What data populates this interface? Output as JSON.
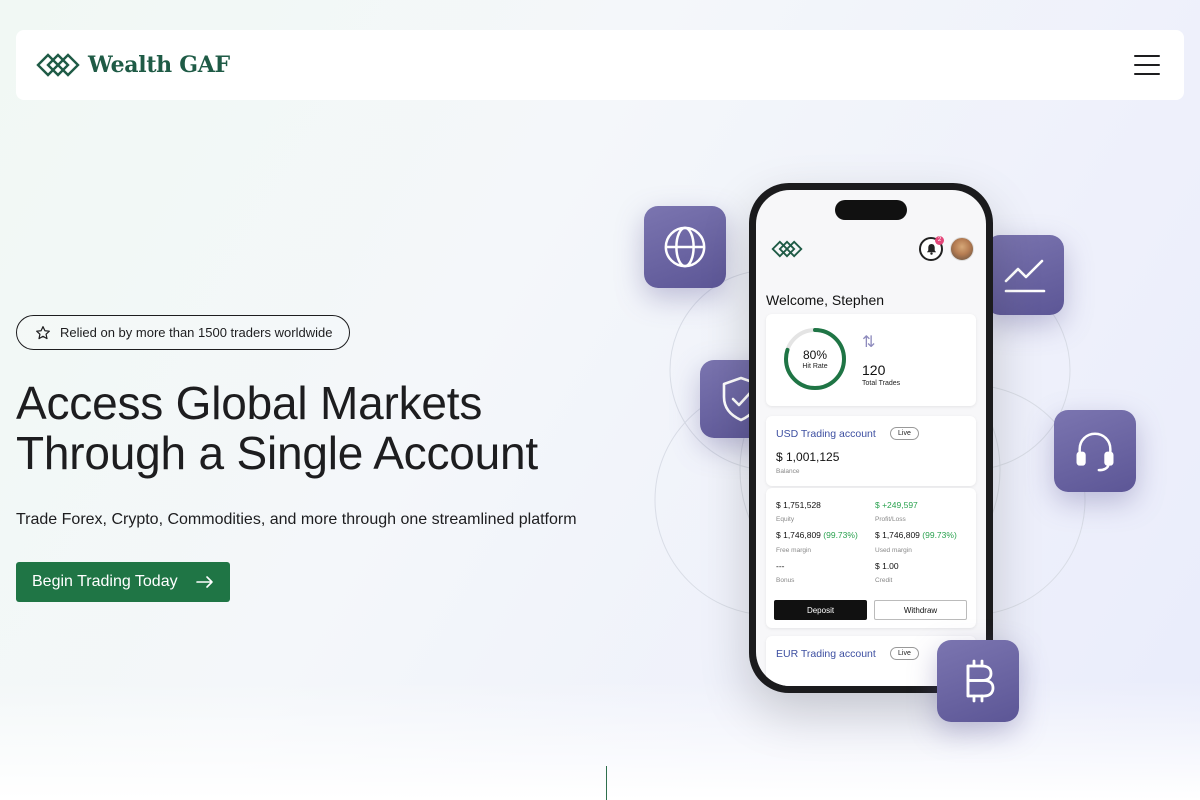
{
  "brand": {
    "name": "Wealth GAF"
  },
  "nav": {
    "menu_icon": "hamburger-menu-icon"
  },
  "hero": {
    "badge": "Relied on by more than 1500 traders worldwide",
    "headline_line1": "Access Global Markets",
    "headline_line2": "Through a Single Account",
    "subline": "Trade Forex, Crypto, Commodities, and more through one streamlined platform",
    "cta_label": "Begin Trading Today"
  },
  "tiles": [
    "globe-icon",
    "trend-chart-icon",
    "shield-check-icon",
    "headset-icon",
    "bitcoin-icon"
  ],
  "phone": {
    "notification_count": "2",
    "welcome": "Welcome, Stephen",
    "hit_rate_value": "80%",
    "hit_rate_progress": 0.8,
    "hit_rate_label": "Hit Rate",
    "total_trades_value": "120",
    "total_trades_label": "Total Trades",
    "usd_account": {
      "title": "USD Trading account",
      "status": "Live",
      "balance": "$ 1,001,125",
      "balance_label": "Balance",
      "equity": "$ 1,751,528",
      "equity_label": "Equity",
      "profit_loss": "$ +249,597",
      "profit_loss_label": "Profit/Loss",
      "free_margin": "$ 1,746,809",
      "free_margin_pct": "(99.73%)",
      "free_margin_label": "Free margin",
      "used_margin": "$ 1,746,809",
      "used_margin_pct": "(99.73%)",
      "used_margin_label": "Used margin",
      "bonus": "---",
      "bonus_label": "Bonus",
      "credit": "$ 1.00",
      "credit_label": "Credit",
      "deposit_label": "Deposit",
      "withdraw_label": "Withdraw"
    },
    "eur_account": {
      "title": "EUR Trading account",
      "status": "Live"
    }
  },
  "colors": {
    "brand_green": "#1f5b46",
    "cta_green": "#1f7545",
    "tile_purple": "#6a64a3",
    "profit_green": "#2aa24f",
    "account_blue": "#3d4fa1"
  }
}
